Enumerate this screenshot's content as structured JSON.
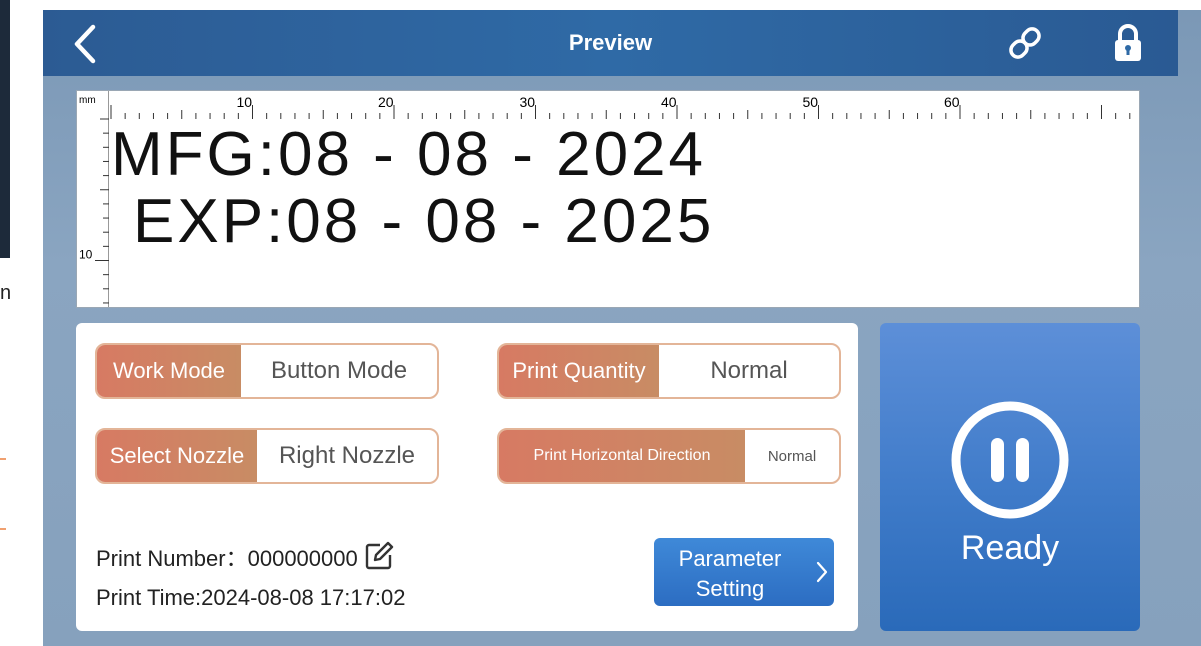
{
  "header": {
    "title": "Preview"
  },
  "preview": {
    "ruler_unit": "mm",
    "ruler_top_labels": [
      "10",
      "20",
      "30",
      "40",
      "50",
      "60"
    ],
    "ruler_left_labels": [
      "10"
    ],
    "lines": [
      "MFG:08 - 08 - 2024",
      "EXP:08 - 08 - 2025"
    ]
  },
  "settings": {
    "work_mode": {
      "label": "Work Mode",
      "value": "Button Mode"
    },
    "print_quantity": {
      "label": "Print Quantity",
      "value": "Normal"
    },
    "select_nozzle": {
      "label": "Select Nozzle",
      "value": "Right Nozzle"
    },
    "print_horizontal_direction": {
      "label": "Print Horizontal Direction",
      "value": "Normal"
    }
  },
  "info": {
    "print_number_label": "Print Number：",
    "print_number_value": "000000000",
    "print_time_label": "Print Time:",
    "print_time_value": "2024-08-08 17:17:02"
  },
  "parameter_button": {
    "line1": "Parameter",
    "line2": "Setting"
  },
  "status": {
    "label": "Ready"
  },
  "icons": {
    "back": "chevron-left-icon",
    "link": "link-icon",
    "lock": "lock-icon",
    "edit": "edit-icon",
    "pause": "pause-icon",
    "chevron": "chevron-right-icon"
  },
  "colors": {
    "header": "#2f6aa6",
    "field_label": "#d77a63",
    "button": "#3a80d0",
    "ready_panel": "#3f7bc9"
  }
}
